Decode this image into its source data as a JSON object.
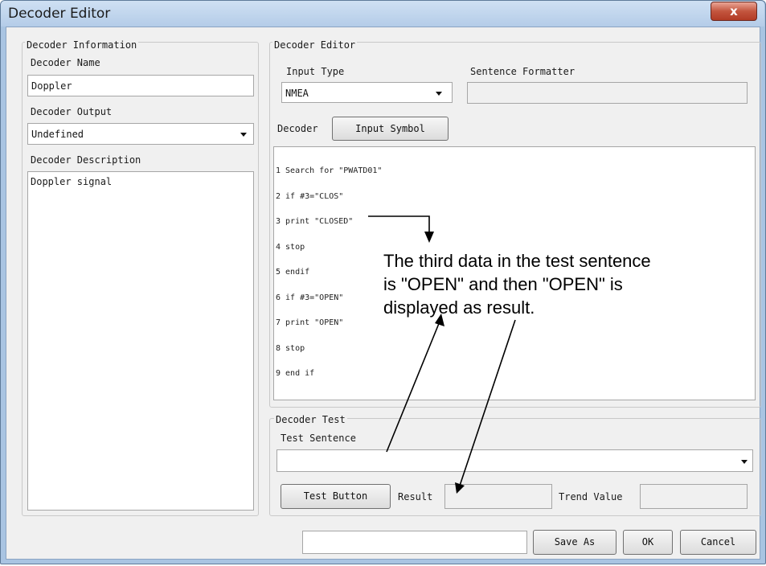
{
  "window": {
    "title": "Decoder Editor",
    "close_label": "x"
  },
  "left_panel": {
    "group_title": "Decoder Information",
    "name_label": "Decoder Name",
    "name_value": "Doppler",
    "output_label": "Decoder Output",
    "output_value": "Undefined",
    "description_label": "Decoder Description",
    "description_value": "Doppler signal"
  },
  "editor": {
    "group_title": "Decoder Editor",
    "input_type_label": "Input Type",
    "input_type_value": "NMEA",
    "formatter_label": "Sentence Formatter",
    "formatter_value": "",
    "decoder_label": "Decoder",
    "input_symbol_button": "Input Symbol",
    "code_lines": [
      "1 Search for \"PWATD01\"",
      "2 if #3=\"CLOS\"",
      "3 print \"CLOSED\"",
      "4 stop",
      "5 endif",
      "6 if #3=\"OPEN\"",
      "7 print \"OPEN\"",
      "8 stop",
      "9 end if"
    ]
  },
  "test": {
    "group_title": "Decoder Test",
    "sentence_label": "Test Sentence",
    "sentence_value": "",
    "test_button": "Test Button",
    "result_label": "Result",
    "result_value": "",
    "trend_label": "Trend Value",
    "trend_value": ""
  },
  "footer": {
    "filename_value": "",
    "save_as_button": "Save As",
    "ok_button": "OK",
    "cancel_button": "Cancel"
  },
  "annotation": {
    "lines": [
      "The third data in the test sentence",
      "is \"OPEN\" and then \"OPEN\" is",
      "displayed as result."
    ]
  }
}
